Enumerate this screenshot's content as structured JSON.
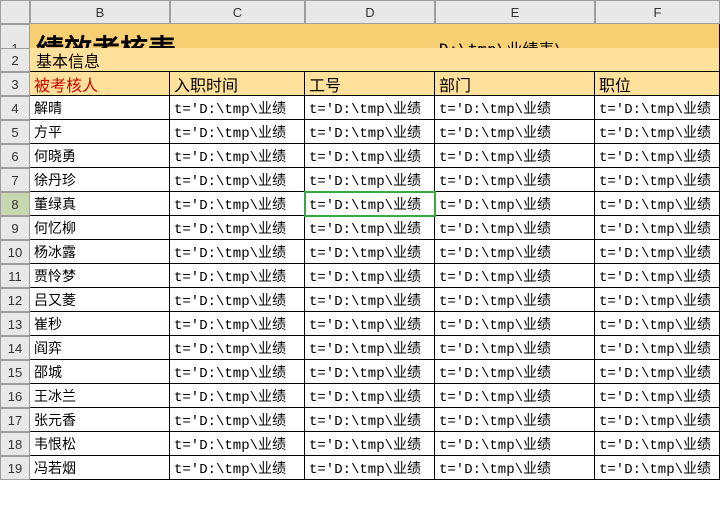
{
  "columns": [
    "B",
    "C",
    "D",
    "E",
    "F"
  ],
  "rows": [
    "1",
    "2",
    "3",
    "4",
    "5",
    "6",
    "7",
    "8",
    "9",
    "10",
    "11",
    "12",
    "13",
    "14",
    "15",
    "16",
    "17",
    "18",
    "19"
  ],
  "title": "绩效考核表",
  "path": "D:\\tmp\\业绩表\\",
  "section": "基本信息",
  "headers": {
    "b": "被考核人",
    "c": "入职时间",
    "d": "工号",
    "e": "部门",
    "f": "职位"
  },
  "names": [
    "解晴",
    "方平",
    "何晓勇",
    "徐丹珍",
    "董绿真",
    "何忆柳",
    "杨冰露",
    "贾怜梦",
    "吕又菱",
    "崔秒",
    "阎弈",
    "邵城",
    "王冰兰",
    "张元香",
    "韦恨松",
    "冯若烟"
  ],
  "formula_c": "t='D:\\tmp\\业绩",
  "formula_d": "t='D:\\tmp\\业绩",
  "formula_e": "t='D:\\tmp\\业绩",
  "formula_f": "t='D:\\tmp\\业绩",
  "active_row": 8,
  "active_col": "D"
}
